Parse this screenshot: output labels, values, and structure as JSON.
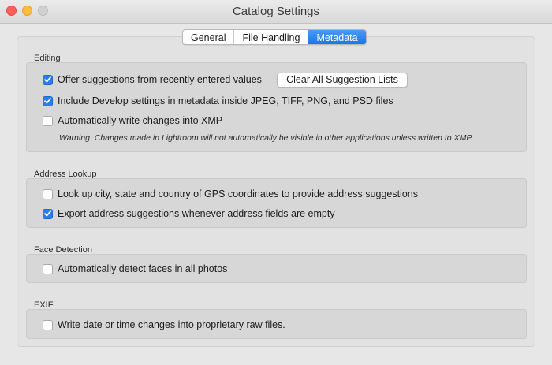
{
  "window": {
    "title": "Catalog Settings"
  },
  "tabs": [
    {
      "label": "General",
      "active": false
    },
    {
      "label": "File Handling",
      "active": false
    },
    {
      "label": "Metadata",
      "active": true
    }
  ],
  "editing": {
    "label": "Editing",
    "offer_suggestions": {
      "label": "Offer suggestions from recently entered values",
      "checked": true
    },
    "clear_button": "Clear All Suggestion Lists",
    "include_develop": {
      "label": "Include Develop settings in metadata inside JPEG, TIFF, PNG, and PSD files",
      "checked": true
    },
    "auto_write_xmp": {
      "label": "Automatically write changes into XMP",
      "checked": false
    },
    "warning": "Warning: Changes made in Lightroom will not automatically be visible in other applications unless written to XMP."
  },
  "address_lookup": {
    "label": "Address Lookup",
    "lookup_gps": {
      "label": "Look up city, state and country of GPS coordinates to provide address suggestions",
      "checked": false
    },
    "export_suggestions": {
      "label": "Export address suggestions whenever address fields are empty",
      "checked": true
    }
  },
  "face_detection": {
    "label": "Face Detection",
    "auto_detect": {
      "label": "Automatically detect faces in all photos",
      "checked": false
    }
  },
  "exif": {
    "label": "EXIF",
    "write_date": {
      "label": "Write date or time changes into proprietary raw files.",
      "checked": false
    }
  },
  "colors": {
    "accent": "#2c7cf1",
    "tab_active": "#1c74ec"
  }
}
